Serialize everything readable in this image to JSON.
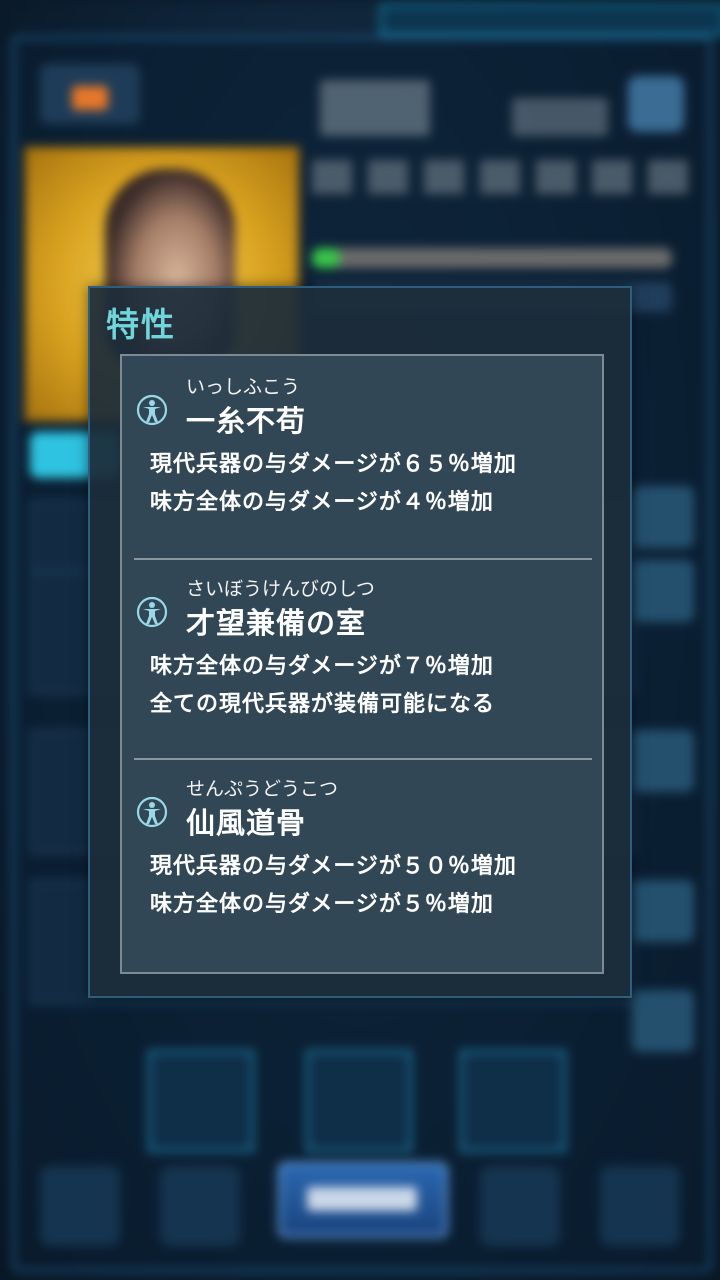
{
  "panel": {
    "title": "特性",
    "traits": [
      {
        "ruby": "いっしふこう",
        "name": "一糸不苟",
        "desc": [
          "現代兵器の与ダメージが６５％増加",
          "味方全体の与ダメージが４％増加"
        ]
      },
      {
        "ruby": "さいぼうけんびのしつ",
        "name": "才望兼備の室",
        "desc": [
          "味方全体の与ダメージが７％増加",
          "全ての現代兵器が装備可能になる"
        ]
      },
      {
        "ruby": "せんぷうどうこつ",
        "name": "仙風道骨",
        "desc": [
          "現代兵器の与ダメージが５０％増加",
          "味方全体の与ダメージが５％増加"
        ]
      }
    ],
    "trait_icon": "person-trait-icon"
  },
  "colors": {
    "title": "#71d6dc",
    "icon": "#9ad8e8",
    "panel_bg": "#324756"
  }
}
